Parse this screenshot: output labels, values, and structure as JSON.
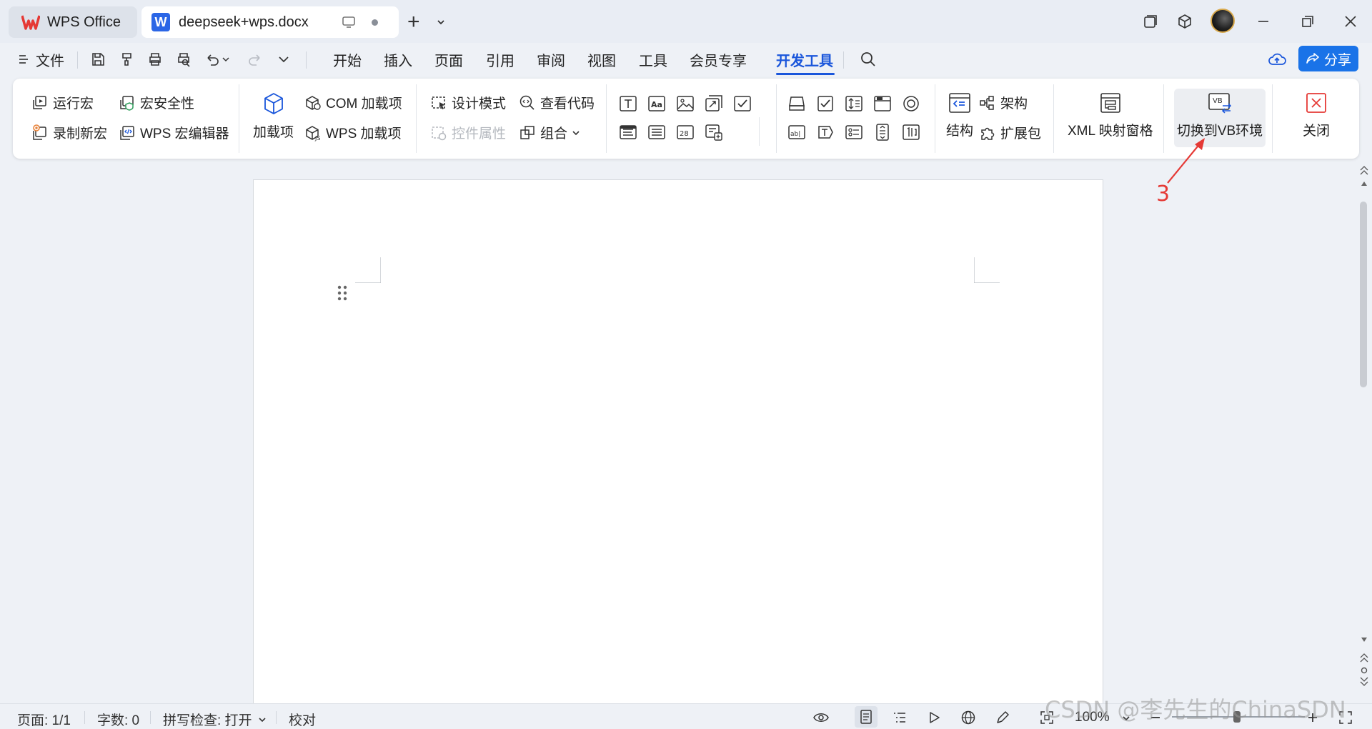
{
  "tabs": {
    "home_label": "WPS Office",
    "doc_icon_letter": "W",
    "doc_label": "deepseek+wps.docx"
  },
  "menubar": {
    "file_label": "文件",
    "tabs": [
      "开始",
      "插入",
      "页面",
      "引用",
      "审阅",
      "视图",
      "工具",
      "会员专享",
      "开发工具"
    ],
    "active_tab": "开发工具",
    "share_label": "分享"
  },
  "ribbon": {
    "run_macro": "运行宏",
    "record_macro": "录制新宏",
    "macro_security": "宏安全性",
    "macro_editor": "WPS 宏编辑器",
    "addins": "加载项",
    "com_addins": "COM 加载项",
    "wps_addins": "WPS 加载项",
    "design_mode": "设计模式",
    "control_props": "控件属性",
    "view_code": "查看代码",
    "group": "组合",
    "structure": "结构",
    "schema": "架构",
    "expansion_pack": "扩展包",
    "xml_pane": "XML 映射窗格",
    "switch_vb": "切换到VB环境",
    "vb_icon_text": "VB",
    "close": "关闭"
  },
  "annotation": {
    "number": "3",
    "color": "#e53935"
  },
  "statusbar": {
    "page": "页面: 1/1",
    "words": "字数: 0",
    "spellcheck": "拼写检查: 打开",
    "proofread": "校对",
    "zoom": "100%"
  },
  "watermark": "CSDN @李先生的ChinaSDN",
  "colors": {
    "accent": "#1a56db",
    "share_button": "#1a73e8",
    "wps_red": "#e53935",
    "doc_blue": "#2b66e6"
  }
}
